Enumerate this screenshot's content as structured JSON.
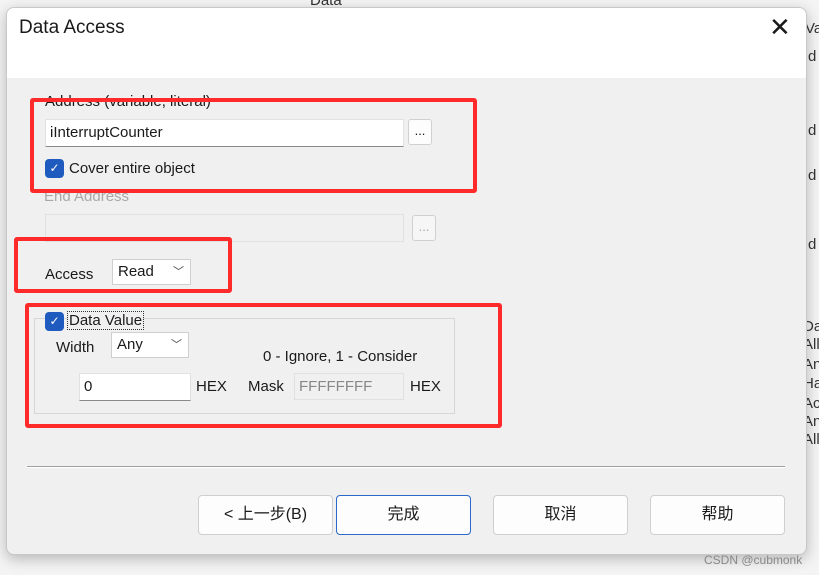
{
  "background": {
    "top_text": "Data",
    "right_texts": [
      "Va",
      "d",
      "d",
      "d",
      "d",
      "Dat",
      "All",
      "Any",
      "Hal",
      "Acc",
      "Any",
      "All"
    ]
  },
  "dialog": {
    "title": "Data Access",
    "close_icon": "close-icon",
    "address": {
      "label": "Address (variable, literal)",
      "value": "iInterruptCounter",
      "browse_label": "..."
    },
    "cover_entire_object": {
      "label": "Cover entire object",
      "checked": true
    },
    "end_address": {
      "label": "End Address",
      "value": "",
      "browse_label": "...",
      "disabled": true
    },
    "access": {
      "label": "Access",
      "selected": "Read"
    },
    "data_value": {
      "label": "Data Value",
      "checked": true,
      "width_label": "Width",
      "width_selected": "Any",
      "hint": "0 - Ignore, 1 - Consider",
      "value": "0",
      "value_unit": "HEX",
      "mask_label": "Mask",
      "mask_value": "FFFFFFFF",
      "mask_unit": "HEX"
    },
    "buttons": {
      "back": "< 上一步(B)",
      "finish": "完成",
      "cancel": "取消",
      "help": "帮助"
    }
  },
  "annotation_color": "#ff2a2a",
  "accent_color": "#1f5bbf",
  "watermark": "CSDN @cubmonk"
}
